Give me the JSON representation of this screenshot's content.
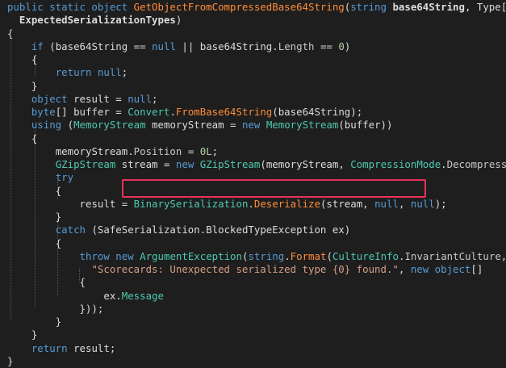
{
  "editor": {
    "theme": {
      "background": "#1e1e1e",
      "highlight_box": "#e8315b",
      "keyword": "#569cd6",
      "type": "#4ec9b0",
      "method": "#ff8c3a",
      "string": "#d69d85",
      "number": "#b5cea8"
    },
    "lines": [
      {
        "indent": "",
        "tokens": [
          {
            "t": "public static object ",
            "c": "kw"
          },
          {
            "t": "GetObjectFromCompressedBase64String",
            "c": "me"
          },
          {
            "t": "(",
            "c": "pn"
          },
          {
            "t": "string ",
            "c": "kw"
          },
          {
            "t": "base64String",
            "c": "pa"
          },
          {
            "t": ", Type[]",
            "c": "pn"
          }
        ]
      },
      {
        "indent": "  ",
        "tokens": [
          {
            "t": "ExpectedSerializationTypes",
            "c": "pa"
          },
          {
            "t": ")",
            "c": "pn"
          }
        ]
      },
      {
        "indent": "",
        "tokens": [
          {
            "t": "{",
            "c": "pn"
          }
        ]
      },
      {
        "indent": "    ",
        "tokens": [
          {
            "t": "if ",
            "c": "kw"
          },
          {
            "t": "(base64String == ",
            "c": "pn"
          },
          {
            "t": "null",
            "c": "kw"
          },
          {
            "t": " || base64String.",
            "c": "pn"
          },
          {
            "t": "Length",
            "c": "pr"
          },
          {
            "t": " == ",
            "c": "pn"
          },
          {
            "t": "0",
            "c": "nu"
          },
          {
            "t": ")",
            "c": "pn"
          }
        ]
      },
      {
        "indent": "    ",
        "tokens": [
          {
            "t": "{",
            "c": "pn"
          }
        ]
      },
      {
        "indent": "        ",
        "tokens": [
          {
            "t": "return ",
            "c": "kw"
          },
          {
            "t": "null",
            "c": "kw"
          },
          {
            "t": ";",
            "c": "pn"
          }
        ]
      },
      {
        "indent": "    ",
        "tokens": [
          {
            "t": "}",
            "c": "pn"
          }
        ]
      },
      {
        "indent": "    ",
        "tokens": [
          {
            "t": "object ",
            "c": "kw"
          },
          {
            "t": "result = ",
            "c": "pn"
          },
          {
            "t": "null",
            "c": "kw"
          },
          {
            "t": ";",
            "c": "pn"
          }
        ]
      },
      {
        "indent": "    ",
        "tokens": [
          {
            "t": "byte",
            "c": "kw"
          },
          {
            "t": "[] buffer = ",
            "c": "pn"
          },
          {
            "t": "Convert",
            "c": "ty"
          },
          {
            "t": ".",
            "c": "pn"
          },
          {
            "t": "FromBase64String",
            "c": "me"
          },
          {
            "t": "(base64String);",
            "c": "pn"
          }
        ]
      },
      {
        "indent": "    ",
        "tokens": [
          {
            "t": "using ",
            "c": "kw"
          },
          {
            "t": "(",
            "c": "pn"
          },
          {
            "t": "MemoryStream",
            "c": "ty"
          },
          {
            "t": " memoryStream = ",
            "c": "pn"
          },
          {
            "t": "new ",
            "c": "kw"
          },
          {
            "t": "MemoryStream",
            "c": "ty"
          },
          {
            "t": "(buffer))",
            "c": "pn"
          }
        ]
      },
      {
        "indent": "    ",
        "tokens": [
          {
            "t": "{",
            "c": "pn"
          }
        ]
      },
      {
        "indent": "        ",
        "tokens": [
          {
            "t": "memoryStream.",
            "c": "pn"
          },
          {
            "t": "Position",
            "c": "pr"
          },
          {
            "t": " = ",
            "c": "pn"
          },
          {
            "t": "0L",
            "c": "nu"
          },
          {
            "t": ";",
            "c": "pn"
          }
        ]
      },
      {
        "indent": "        ",
        "tokens": [
          {
            "t": "GZipStream",
            "c": "ty"
          },
          {
            "t": " stream = ",
            "c": "pn"
          },
          {
            "t": "new ",
            "c": "kw"
          },
          {
            "t": "GZipStream",
            "c": "ty"
          },
          {
            "t": "(memoryStream, ",
            "c": "pn"
          },
          {
            "t": "CompressionMode",
            "c": "ty"
          },
          {
            "t": ".",
            "c": "pn"
          },
          {
            "t": "Decompress",
            "c": "pr"
          },
          {
            "t": ");",
            "c": "pn"
          }
        ]
      },
      {
        "indent": "        ",
        "tokens": [
          {
            "t": "try",
            "c": "kw"
          }
        ]
      },
      {
        "indent": "        ",
        "tokens": [
          {
            "t": "{",
            "c": "pn"
          }
        ]
      },
      {
        "indent": "            ",
        "tokens": [
          {
            "t": "result = ",
            "c": "pn"
          },
          {
            "t": "BinarySerialization",
            "c": "ty"
          },
          {
            "t": ".",
            "c": "pn"
          },
          {
            "t": "Deserialize",
            "c": "me"
          },
          {
            "t": "(stream, ",
            "c": "pn"
          },
          {
            "t": "null",
            "c": "kw"
          },
          {
            "t": ", ",
            "c": "pn"
          },
          {
            "t": "null",
            "c": "kw"
          },
          {
            "t": ");",
            "c": "pn"
          }
        ]
      },
      {
        "indent": "        ",
        "tokens": [
          {
            "t": "}",
            "c": "pn"
          }
        ]
      },
      {
        "indent": "        ",
        "tokens": [
          {
            "t": "catch ",
            "c": "kw"
          },
          {
            "t": "(SafeSerialization.BlockedTypeException ex)",
            "c": "pn"
          }
        ]
      },
      {
        "indent": "        ",
        "tokens": [
          {
            "t": "{",
            "c": "pn"
          }
        ]
      },
      {
        "indent": "            ",
        "tokens": [
          {
            "t": "throw ",
            "c": "kw"
          },
          {
            "t": "new ",
            "c": "kw"
          },
          {
            "t": "ArgumentException",
            "c": "ty"
          },
          {
            "t": "(",
            "c": "pn"
          },
          {
            "t": "string",
            "c": "kw"
          },
          {
            "t": ".",
            "c": "pn"
          },
          {
            "t": "Format",
            "c": "me"
          },
          {
            "t": "(",
            "c": "pn"
          },
          {
            "t": "CultureInfo",
            "c": "ty"
          },
          {
            "t": ".",
            "c": "pn"
          },
          {
            "t": "InvariantCulture",
            "c": "pr"
          },
          {
            "t": ",",
            "c": "pn"
          }
        ]
      },
      {
        "indent": "              ",
        "tokens": [
          {
            "t": "\"Scorecards: Unexpected serialized type {0} found.\"",
            "c": "st"
          },
          {
            "t": ", ",
            "c": "pn"
          },
          {
            "t": "new ",
            "c": "kw"
          },
          {
            "t": "object",
            "c": "kw"
          },
          {
            "t": "[]",
            "c": "pn"
          }
        ]
      },
      {
        "indent": "            ",
        "tokens": [
          {
            "t": "{",
            "c": "pn"
          }
        ]
      },
      {
        "indent": "                ",
        "tokens": [
          {
            "t": "ex.",
            "c": "pn"
          },
          {
            "t": "Message",
            "c": "ty"
          }
        ]
      },
      {
        "indent": "            ",
        "tokens": [
          {
            "t": "}));",
            "c": "pn"
          }
        ]
      },
      {
        "indent": "        ",
        "tokens": [
          {
            "t": "}",
            "c": "pn"
          }
        ]
      },
      {
        "indent": "    ",
        "tokens": [
          {
            "t": "}",
            "c": "pn"
          }
        ]
      },
      {
        "indent": "    ",
        "tokens": [
          {
            "t": "return ",
            "c": "kw"
          },
          {
            "t": "result;",
            "c": "pn"
          }
        ]
      },
      {
        "indent": "",
        "tokens": [
          {
            "t": "}",
            "c": "pn"
          }
        ]
      }
    ]
  }
}
